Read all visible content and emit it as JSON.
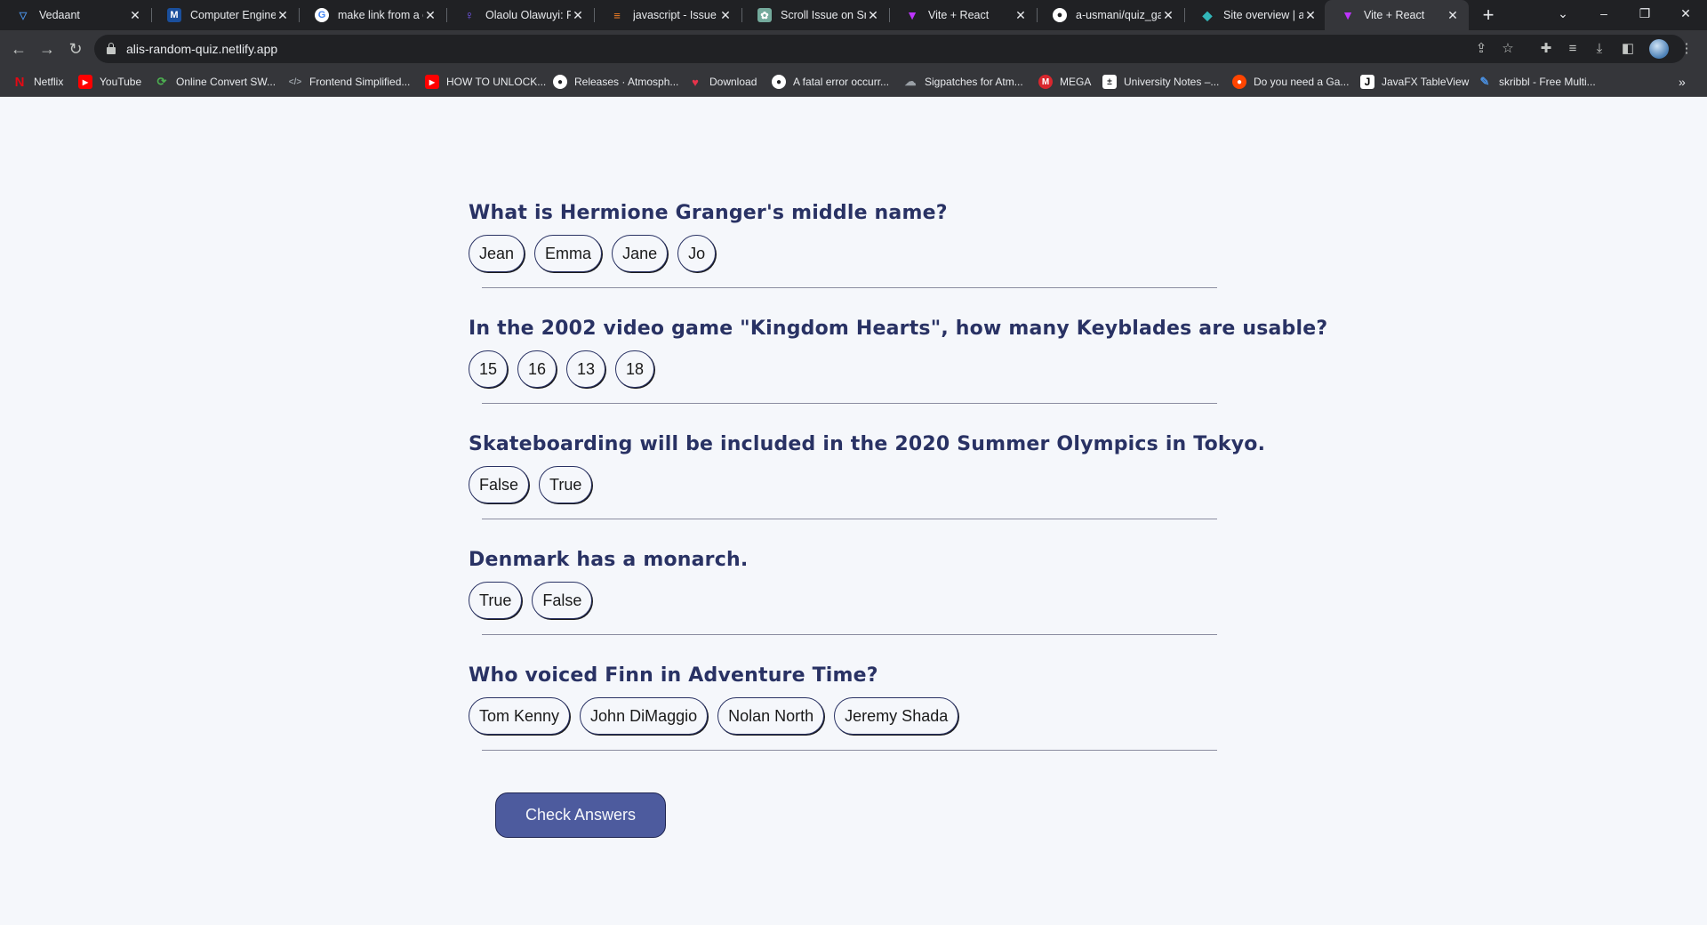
{
  "browser": {
    "tabs": [
      {
        "title": "Vedaant",
        "icon": "vpn-shield-icon",
        "color": "#4a8fe0"
      },
      {
        "title": "Computer Enginee",
        "icon": "m-logo-icon",
        "color": "#1a4f9c"
      },
      {
        "title": "make link from a e",
        "icon": "google-icon",
        "color": "#ffffff"
      },
      {
        "title": "Olaolu Olawuyi: Fr",
        "icon": "pin-icon",
        "color": "#7b5cff"
      },
      {
        "title": "javascript - Issue w",
        "icon": "stackoverflow-icon",
        "color": "#f48024"
      },
      {
        "title": "Scroll Issue on Sm",
        "icon": "chatgpt-icon",
        "color": "#74aa9c"
      },
      {
        "title": "Vite + React",
        "icon": "vite-icon",
        "color": "#bd34fe"
      },
      {
        "title": "a-usmani/quiz_gan",
        "icon": "github-icon",
        "color": "#ffffff"
      },
      {
        "title": "Site overview | alis",
        "icon": "netlify-icon",
        "color": "#32b6b9"
      },
      {
        "title": "Vite + React",
        "icon": "vite-icon",
        "color": "#bd34fe"
      }
    ],
    "url": "alis-random-quiz.netlify.app",
    "bookmarks": [
      {
        "label": "Netflix",
        "icon": "netflix-icon",
        "color": "#e50914"
      },
      {
        "label": "YouTube",
        "icon": "youtube-icon",
        "color": "#ff0000"
      },
      {
        "label": "Online Convert SW...",
        "icon": "convert-icon",
        "color": "#4caf50"
      },
      {
        "label": "Frontend Simplified...",
        "icon": "code-icon",
        "color": "#9aa0a6"
      },
      {
        "label": "HOW TO UNLOCK...",
        "icon": "youtube-icon",
        "color": "#ff0000"
      },
      {
        "label": "Releases · Atmosph...",
        "icon": "github-icon",
        "color": "#ffffff"
      },
      {
        "label": "Download",
        "icon": "download-site-icon",
        "color": "#e5334b"
      },
      {
        "label": "A fatal error occurr...",
        "icon": "github-icon",
        "color": "#ffffff"
      },
      {
        "label": "Sigpatches for Atm...",
        "icon": "forum-icon",
        "color": "#9aa0a6"
      },
      {
        "label": "MEGA",
        "icon": "mega-icon",
        "color": "#d9272e"
      },
      {
        "label": "University Notes –...",
        "icon": "notes-icon",
        "color": "#ffffff"
      },
      {
        "label": "Do you need a Ga...",
        "icon": "reddit-icon",
        "color": "#ff4500"
      },
      {
        "label": "JavaFX TableView",
        "icon": "j-icon",
        "color": "#ffffff"
      },
      {
        "label": "skribbl - Free Multi...",
        "icon": "pencil-icon",
        "color": "#4a8fe0"
      }
    ]
  },
  "quiz": {
    "questions": [
      {
        "text": "What is Hermione Granger's middle name?",
        "answers": [
          "Jean",
          "Emma",
          "Jane",
          "Jo"
        ]
      },
      {
        "text": "In the 2002 video game \"Kingdom Hearts\", how many Keyblades are usable?",
        "answers": [
          "15",
          "16",
          "13",
          "18"
        ]
      },
      {
        "text": "Skateboarding will be included in the 2020 Summer Olympics in Tokyo.",
        "answers": [
          "False",
          "True"
        ]
      },
      {
        "text": "Denmark has a monarch.",
        "answers": [
          "True",
          "False"
        ]
      },
      {
        "text": "Who voiced Finn in Adventure Time?",
        "answers": [
          "Tom Kenny",
          "John DiMaggio",
          "Nolan North",
          "Jeremy Shada"
        ]
      }
    ],
    "check_button": "Check Answers"
  },
  "colors": {
    "question_text": "#293264",
    "page_background": "#f5f7fb",
    "button_background": "#4d5b9e"
  }
}
